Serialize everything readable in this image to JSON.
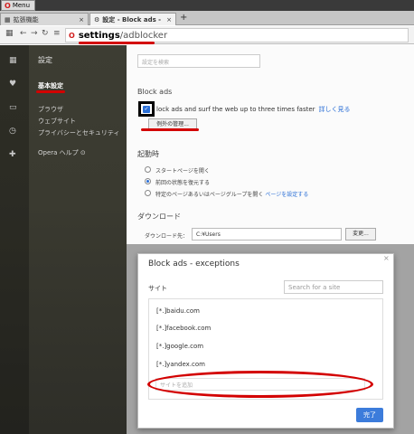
{
  "browser": {
    "menu_label": "Menu",
    "tabs": [
      {
        "label": "拡張機能"
      },
      {
        "label": "設定 - Block ads -"
      }
    ],
    "url_host": "settings",
    "url_path": "/adblocker"
  },
  "sidebar": {
    "title": "設定",
    "items": [
      {
        "label": "基本設定"
      },
      {
        "label": "ブラウザ"
      },
      {
        "label": "ウェブサイト"
      },
      {
        "label": "プライバシーとセキュリティ"
      },
      {
        "label": "Opera ヘルプ"
      }
    ]
  },
  "settings": {
    "search_placeholder": "設定を検索",
    "block_ads": {
      "heading": "Block ads",
      "checkbox_text": "lock ads and surf the web up to three times faster",
      "link": "詳しく見る",
      "manage_button": "例外の管理..."
    },
    "startup": {
      "heading": "起動時",
      "options": [
        {
          "label": "スタートページを開く"
        },
        {
          "label": "前回の状態を復元する"
        },
        {
          "label": "特定のページあるいはページグループを開く",
          "link": "ページを設定する"
        }
      ]
    },
    "download": {
      "heading": "ダウンロード",
      "label": "ダウンロード先：",
      "path": "C:¥Users",
      "change_button": "変更..."
    }
  },
  "dialog": {
    "title": "Block ads - exceptions",
    "site_label": "サイト",
    "search_placeholder": "Search for a site",
    "sites": [
      "[*.]baidu.com",
      "[*.]facebook.com",
      "[*.]google.com",
      "[*.]yandex.com"
    ],
    "add_placeholder": "サイトを追加",
    "done_button": "完了"
  }
}
